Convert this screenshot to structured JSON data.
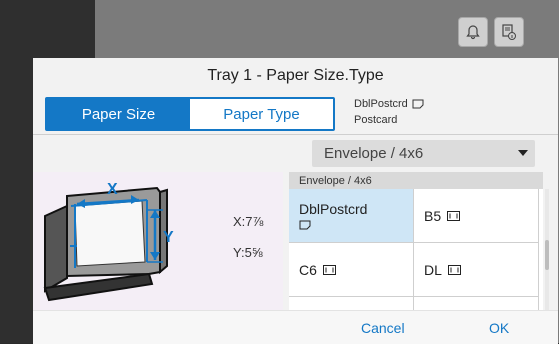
{
  "header": {
    "icons": [
      "bell-icon",
      "tray-info-icon"
    ]
  },
  "dialog": {
    "title": "Tray 1 - Paper Size.Type",
    "tabs": [
      {
        "label": "Paper Size",
        "active": true
      },
      {
        "label": "Paper Type",
        "active": false
      }
    ],
    "current_size": "DblPostcrd",
    "current_type": "Postcard",
    "dropdown": {
      "selected": "Envelope / 4x6"
    },
    "dimensions": {
      "x": "X:7⅞",
      "y": "Y:5⅝"
    },
    "list_header": "Envelope / 4x6",
    "options": [
      {
        "label": "DblPostcrd",
        "selected": true
      },
      {
        "label": "B5",
        "selected": false
      },
      {
        "label": "C6",
        "selected": false
      },
      {
        "label": "DL",
        "selected": false
      }
    ],
    "buttons": {
      "cancel": "Cancel",
      "ok": "OK"
    }
  },
  "colors": {
    "accent": "#1478c6",
    "selected_cell": "#cfe6f6"
  }
}
